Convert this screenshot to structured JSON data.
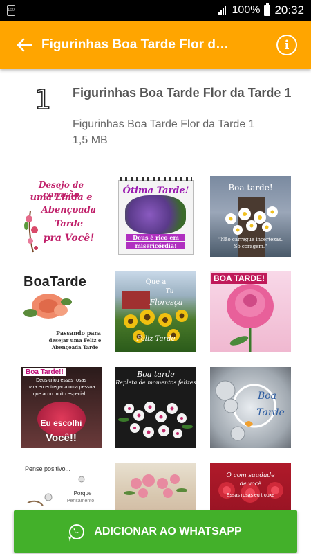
{
  "status_bar": {
    "battery_percent": "100%",
    "time": "20:32",
    "left_icon": "100"
  },
  "appbar": {
    "title": "Figurinhas Boa Tarde Flor da...",
    "back_icon": "arrow-left-icon",
    "info_icon": "info-icon"
  },
  "pack": {
    "number": "1",
    "title": "Figurinhas Boa Tarde Flor da Tarde 1",
    "name": "Figurinhas Boa Tarde Flor da Tarde 1",
    "size": "1,5 MB"
  },
  "stickers": [
    {
      "line1": "Desejo de coração",
      "line2": "uma Linda e",
      "line3": "Abençoada",
      "line4": "Tarde",
      "line5": "pra Você!"
    },
    {
      "line1": "Ótima Tarde!",
      "line2": "Deus é rico em",
      "line3": "misericórdia!"
    },
    {
      "line1": "Boa tarde!",
      "line2": "\"Não carregue incertezas.",
      "line3": "Só coragem.\""
    },
    {
      "line1": "BoaTarde",
      "line2": "Passando para",
      "line3": "desejar uma Feliz e",
      "line4": "Abençoada Tarde"
    },
    {
      "line1": "Que a",
      "line2": "Tu",
      "line3": "Floresça",
      "line4": "Feliz Tarde"
    },
    {
      "line1": "BOA TARDE!"
    },
    {
      "line1": "Boa Tarde!!",
      "line2": "Deus criou essas rosas",
      "line3": "para eu entregar a uma pessoa",
      "line4": "que acho muito especial...",
      "line5": "Eu escolhi",
      "line6": "Você!!"
    },
    {
      "line1": "Boa tarde",
      "line2": "Repleta de momentos felizes"
    },
    {
      "line1": "Boa",
      "line2": "Tarde"
    },
    {
      "line1": "Pense positivo...",
      "line2": "Porque",
      "line3": "Pensamento"
    },
    {
      "line1": ""
    },
    {
      "line1": "O com saudade",
      "line2": "de você",
      "line3": "Essas rosas eu trouxe"
    }
  ],
  "add_button": {
    "label": "ADICIONAR AO WHATSAPP"
  },
  "colors": {
    "appbar": "#ffa500",
    "button": "#43b02a"
  }
}
